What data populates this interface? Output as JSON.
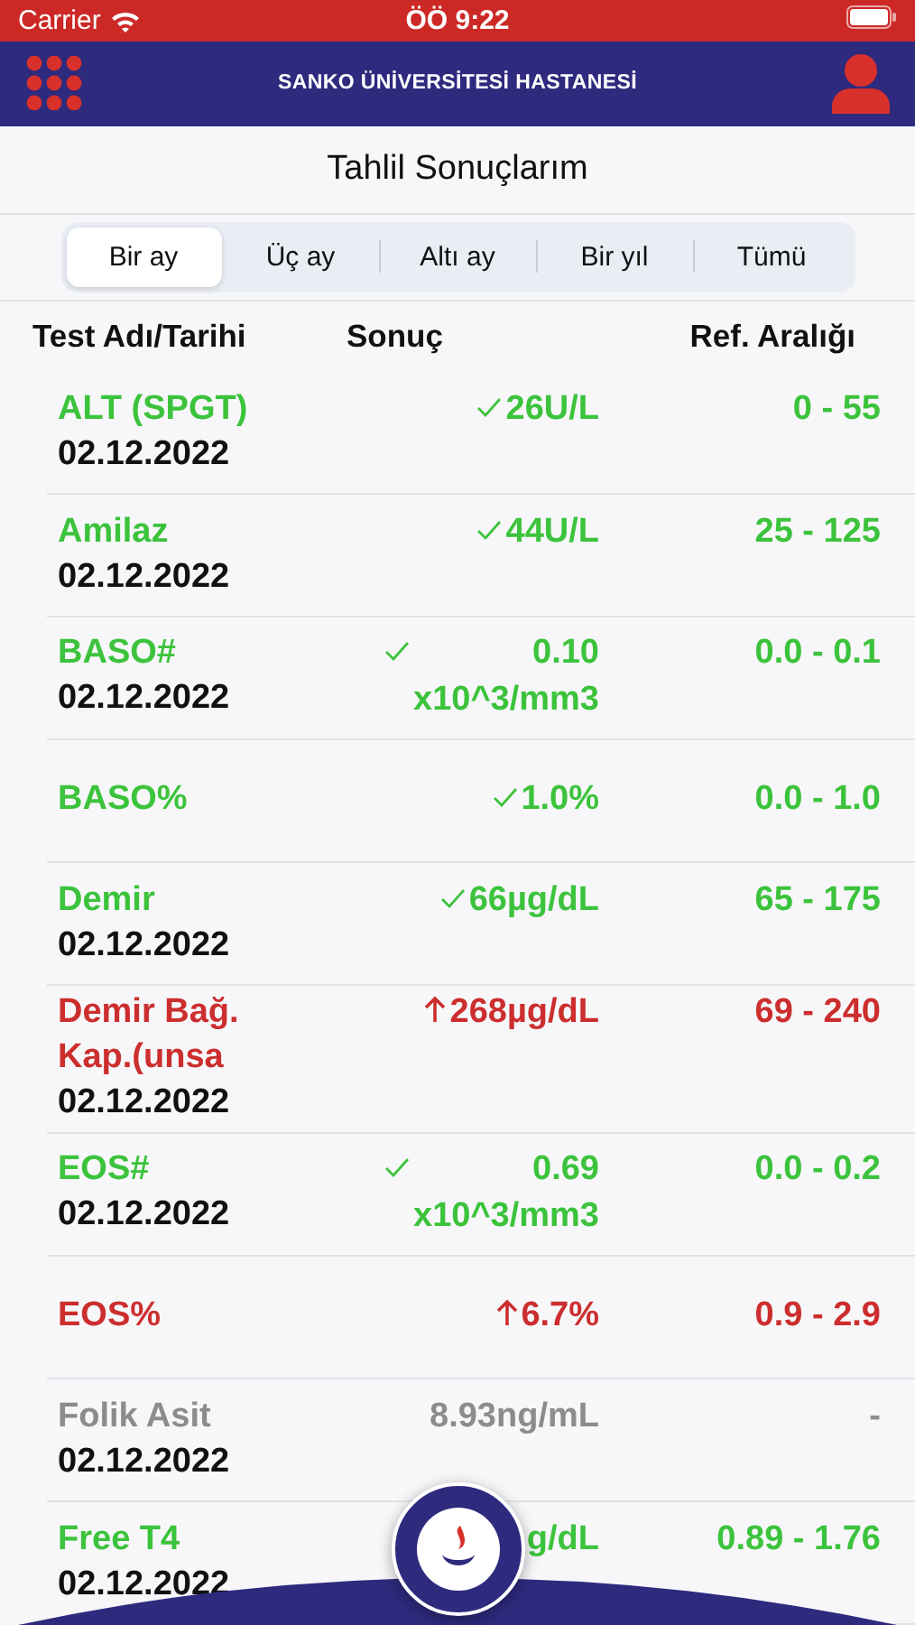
{
  "status_bar": {
    "carrier": "Carrier",
    "time": "ÖÖ 9:22"
  },
  "header": {
    "title": "SANKO ÜNİVERSİTESİ HASTANESİ"
  },
  "page_title": "Tahlil Sonuçlarım",
  "tabs": [
    {
      "label": "Bir ay",
      "selected": true
    },
    {
      "label": "Üç ay",
      "selected": false
    },
    {
      "label": "Altı ay",
      "selected": false
    },
    {
      "label": "Bir yıl",
      "selected": false
    },
    {
      "label": "Tümü",
      "selected": false
    }
  ],
  "table": {
    "columns": [
      "Test Adı/Tarihi",
      "Sonuç",
      "Ref. Aralığı"
    ],
    "rows": [
      {
        "name": "ALT (SPGT)",
        "date": "02.12.2022",
        "kind": "normal",
        "result": "26U/L",
        "range": "0 - 55"
      },
      {
        "name": "Amilaz",
        "date": "02.12.2022",
        "kind": "normal",
        "result": "44U/L",
        "range": "25 - 125"
      },
      {
        "name": "BASO#",
        "date": "02.12.2022",
        "kind": "normal",
        "result": "0.10 x10^3/mm3",
        "range": "0.0 - 0.1"
      },
      {
        "name": "BASO%",
        "kind": "normal",
        "result": "1.0%",
        "range": "0.0 - 1.0"
      },
      {
        "name": "Demir",
        "date": "02.12.2022",
        "kind": "normal",
        "result": "66µg/dL",
        "range": "65 - 175"
      },
      {
        "name": "Demir Bağ. Kap.(unsa",
        "date": "02.12.2022",
        "kind": "high",
        "result": "268µg/dL",
        "range": "69 - 240"
      },
      {
        "name": "EOS#",
        "date": "02.12.2022",
        "kind": "normal",
        "result": "0.69 x10^3/mm3",
        "range": "0.0 - 0.2"
      },
      {
        "name": "EOS%",
        "kind": "high",
        "result": "6.7%",
        "range": "0.9 - 2.9"
      },
      {
        "name": "Folik Asit",
        "date": "02.12.2022",
        "kind": "none",
        "result": "8.93ng/mL",
        "range": "-"
      },
      {
        "name": "Free T4",
        "date": "02.12.2022",
        "kind": "normal",
        "result": "g/dL",
        "range": "0.89 - 1.76"
      }
    ]
  }
}
